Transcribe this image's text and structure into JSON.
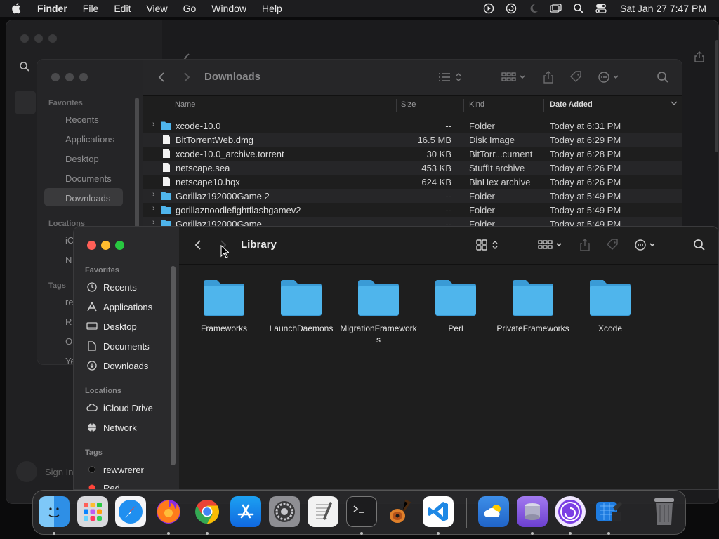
{
  "menubar": {
    "app_name": "Finder",
    "menus": [
      "File",
      "Edit",
      "View",
      "Go",
      "Window",
      "Help"
    ],
    "clock": "Sat Jan 27  7:47 PM"
  },
  "background_window": {
    "sign_in": "Sign In"
  },
  "downloads_window": {
    "title": "Downloads",
    "sidebar": {
      "favorites_header": "Favorites",
      "favorites": [
        "Recents",
        "Applications",
        "Desktop",
        "Documents",
        "Downloads"
      ],
      "locations_header": "Locations",
      "locations_partial": [
        "iC",
        "N"
      ],
      "tags_header": "Tags",
      "tags_partial": [
        "re",
        "R",
        "O",
        "Ye"
      ]
    },
    "columns": {
      "name": "Name",
      "size": "Size",
      "kind": "Kind",
      "date": "Date Added"
    },
    "rows": [
      {
        "name": "xcode-10.0",
        "size": "--",
        "kind": "Folder",
        "date": "Today at 6:31 PM",
        "icon": "folder-icon",
        "expandable": true
      },
      {
        "name": "BitTorrentWeb.dmg",
        "size": "16.5 MB",
        "kind": "Disk Image",
        "date": "Today at 6:29 PM",
        "icon": "document-icon",
        "expandable": false
      },
      {
        "name": "xcode-10.0_archive.torrent",
        "size": "30 KB",
        "kind": "BitTorr...cument",
        "date": "Today at 6:28 PM",
        "icon": "document-icon",
        "expandable": false
      },
      {
        "name": "netscape.sea",
        "size": "453 KB",
        "kind": "StuffIt archive",
        "date": "Today at 6:26 PM",
        "icon": "document-icon",
        "expandable": false
      },
      {
        "name": "netscape10.hqx",
        "size": "624 KB",
        "kind": "BinHex archive",
        "date": "Today at 6:26 PM",
        "icon": "document-icon",
        "expandable": false
      },
      {
        "name": "Gorillaz192000Game 2",
        "size": "--",
        "kind": "Folder",
        "date": "Today at 5:49 PM",
        "icon": "folder-icon",
        "expandable": true
      },
      {
        "name": "gorillaznoodlefightflashgamev2",
        "size": "--",
        "kind": "Folder",
        "date": "Today at 5:49 PM",
        "icon": "folder-icon",
        "expandable": true
      },
      {
        "name": "Gorillaz192000Game",
        "size": "--",
        "kind": "Folder",
        "date": "Today at 5:49 PM",
        "icon": "folder-icon",
        "expandable": true
      }
    ]
  },
  "library_window": {
    "title": "Library",
    "sidebar": {
      "favorites_header": "Favorites",
      "favorites": [
        {
          "label": "Recents",
          "icon": "clock-icon"
        },
        {
          "label": "Applications",
          "icon": "applications-icon"
        },
        {
          "label": "Desktop",
          "icon": "desktop-icon"
        },
        {
          "label": "Documents",
          "icon": "document-icon"
        },
        {
          "label": "Downloads",
          "icon": "download-icon"
        }
      ],
      "locations_header": "Locations",
      "locations": [
        {
          "label": "iCloud Drive",
          "icon": "cloud-icon"
        },
        {
          "label": "Network",
          "icon": "globe-icon"
        }
      ],
      "tags_header": "Tags",
      "tags": [
        {
          "label": "rewwrerer",
          "color": "#1a1a1a"
        },
        {
          "label": "Red",
          "color": "#ff453a"
        }
      ]
    },
    "folders": [
      "Frameworks",
      "LaunchDaemons",
      "MigrationFrameworks",
      "Perl",
      "PrivateFrameworks",
      "Xcode"
    ]
  },
  "colors": {
    "folder_blue": "#4fb5ec",
    "folder_blue_dark": "#3a9bd6",
    "close": "#ff5f57",
    "minimize": "#febc2e",
    "zoom": "#28c840"
  },
  "dock": {
    "apps": [
      {
        "name": "finder-icon",
        "running": true
      },
      {
        "name": "launchpad-icon",
        "running": false
      },
      {
        "name": "safari-icon",
        "running": false
      },
      {
        "name": "firefox-icon",
        "running": true
      },
      {
        "name": "chrome-icon",
        "running": true
      },
      {
        "name": "app-store-icon",
        "running": false
      },
      {
        "name": "system-settings-icon",
        "running": false
      },
      {
        "name": "textedit-icon",
        "running": false
      },
      {
        "name": "terminal-icon",
        "running": true
      },
      {
        "name": "garageband-icon",
        "running": false
      },
      {
        "name": "vscode-icon",
        "running": true
      },
      {
        "name": "weather-icon",
        "running": false
      },
      {
        "name": "disk-utility-icon",
        "running": true
      },
      {
        "name": "bittorrent-icon",
        "running": true
      },
      {
        "name": "xcode-installer-icon",
        "running": true
      },
      {
        "name": "trash-icon",
        "running": false
      }
    ]
  }
}
